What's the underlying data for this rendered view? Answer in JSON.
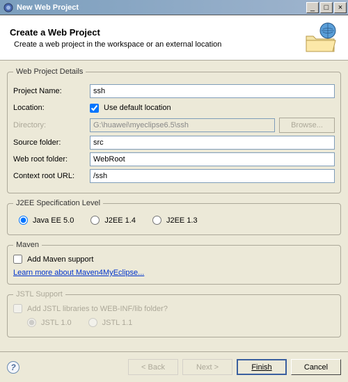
{
  "titlebar": {
    "text": "New Web Project"
  },
  "banner": {
    "title": "Create a Web Project",
    "subtitle": "Create a web project in the workspace or an external location"
  },
  "details": {
    "legend": "Web Project Details",
    "projectNameLabel": "Project Name:",
    "projectName": "ssh",
    "locationLabel": "Location:",
    "useDefaultLabel": "Use default location",
    "useDefault": true,
    "directoryLabel": "Directory:",
    "directory": "G:\\huawei\\myeclipse6.5\\ssh",
    "browseLabel": "Browse...",
    "sourceFolderLabel": "Source folder:",
    "sourceFolder": "src",
    "webRootLabel": "Web root folder:",
    "webRoot": "WebRoot",
    "contextRootLabel": "Context root URL:",
    "contextRoot": "/ssh"
  },
  "j2ee": {
    "legend": "J2EE Specification Level",
    "options": {
      "opt0": "Java EE 5.0",
      "opt1": "J2EE 1.4",
      "opt2": "J2EE 1.3"
    },
    "selected": 0
  },
  "maven": {
    "legend": "Maven",
    "addSupportLabel": "Add Maven support",
    "addSupport": false,
    "learnMore": "Learn more about Maven4MyEclipse..."
  },
  "jstl": {
    "legend": "JSTL Support",
    "addLibLabel": "Add JSTL libraries to WEB-INF/lib folder?",
    "options": {
      "opt0": "JSTL 1.0",
      "opt1": "JSTL 1.1"
    }
  },
  "buttons": {
    "back": "< Back",
    "next": "Next >",
    "finish": "Finish",
    "cancel": "Cancel"
  }
}
